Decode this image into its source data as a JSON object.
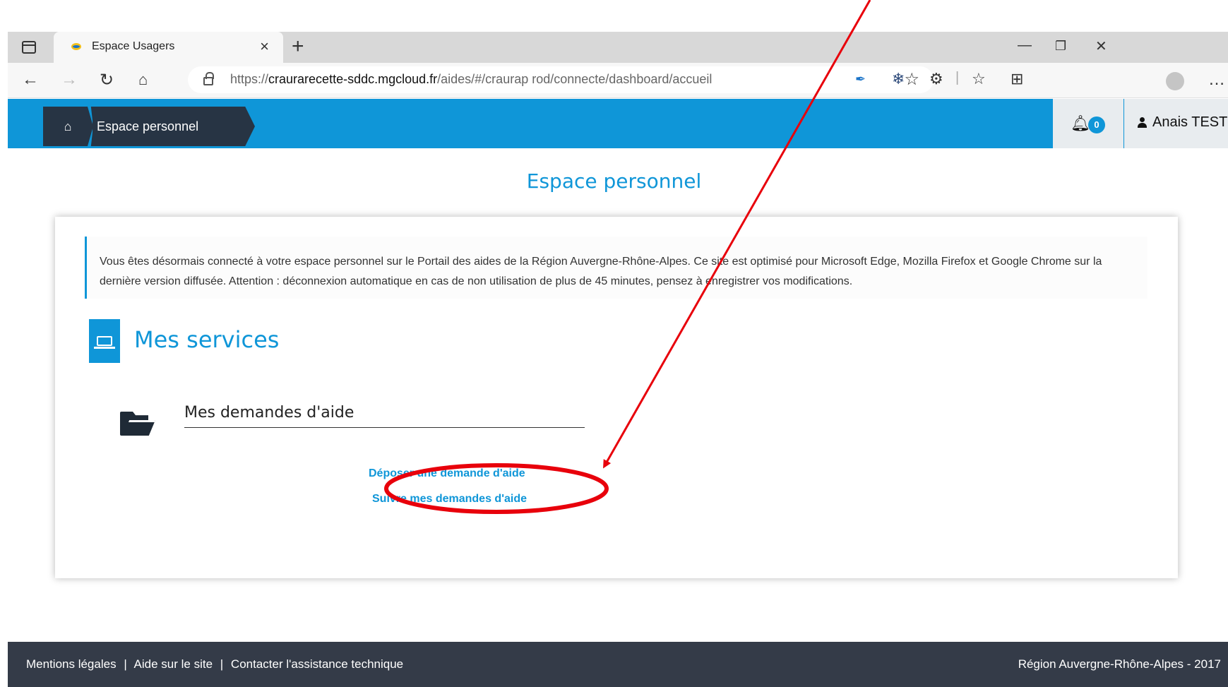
{
  "browser": {
    "tab_title": "Espace Usagers",
    "tab_close": "×",
    "new_tab": "+",
    "url_prefix": "https://",
    "url_domain": "craurarecette-sddc.mgcloud.fr",
    "url_path": "/aides/#/craurap rod/connecte/dashboard/accueil",
    "icons": [
      "tab-actions-icon",
      "back-icon",
      "forward-icon",
      "refresh-icon",
      "home-icon",
      "lock-icon",
      "add-favorite-icon",
      "extension-pen-icon",
      "extension-snowflake-icon",
      "extensions-icon",
      "favorites-icon",
      "collections-icon",
      "profile-icon",
      "more-icon",
      "minimize-icon",
      "restore-icon",
      "close-window-icon"
    ]
  },
  "header": {
    "breadcrumb_home_icon": "home-icon",
    "breadcrumb_current": "Espace personnel",
    "notifications_count": "0",
    "user_name": "Anais TEST",
    "colors": {
      "bar": "#0f96d8",
      "breadcrumb": "#273444",
      "panel": "#e8ecef"
    }
  },
  "main": {
    "page_title": "Espace personnel",
    "notice": "Vous êtes désormais connecté à votre espace personnel sur le Portail des aides de la Région Auvergne-Rhône-Alpes. Ce site est optimisé pour Microsoft Edge, Mozilla Firefox et Google Chrome sur la dernière version diffusée. Attention : déconnexion automatique en cas de non utilisation de plus de 45 minutes, pensez à enregistrer vos modifications.",
    "services_title": "Mes services",
    "services_icon": "laptop-icon",
    "demandes_icon": "folder-open-icon",
    "demandes_title": "Mes demandes d'aide",
    "link_deposer": "Déposer une demande d'aide",
    "link_suivre": "Suivre mes demandes d'aide"
  },
  "footer": {
    "mentions": "Mentions légales",
    "aide": "Aide sur le site",
    "contact": "Contacter l'assistance technique",
    "separator": "|",
    "copyright": "Région Auvergne-Rhône-Alpes - 2017"
  },
  "annotation": {
    "color": "#e8000b"
  }
}
